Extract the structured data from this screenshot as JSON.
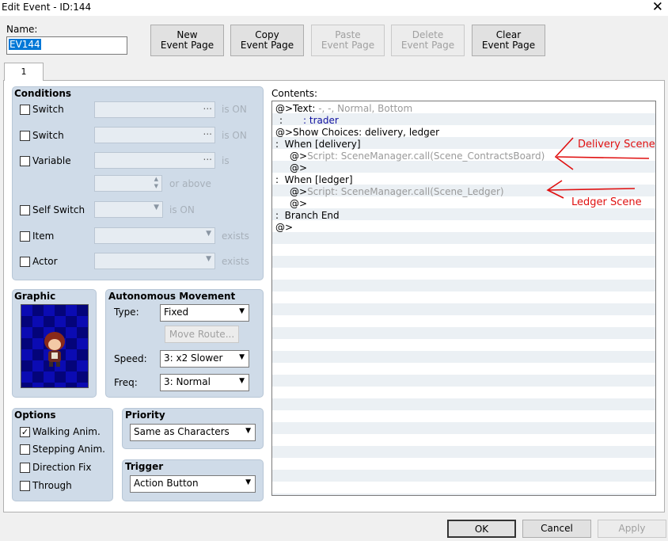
{
  "window": {
    "title": "Edit Event - ID:144",
    "close_glyph": "✕"
  },
  "name_label": "Name:",
  "name_value": "EV144",
  "toolbar": {
    "new_line1": "New",
    "new_line2": "Event Page",
    "copy_line1": "Copy",
    "copy_line2": "Event Page",
    "paste_line1": "Paste",
    "paste_line2": "Event Page",
    "delete_line1": "Delete",
    "delete_line2": "Event Page",
    "clear_line1": "Clear",
    "clear_line2": "Event Page"
  },
  "tabs": [
    {
      "label": "1"
    }
  ],
  "conditions": {
    "title": "Conditions",
    "switch1_label": "Switch",
    "switch1_suffix": "is ON",
    "switch2_label": "Switch",
    "switch2_suffix": "is ON",
    "variable_label": "Variable",
    "variable_suffix": "is",
    "variable_above": "or above",
    "self_switch_label": "Self Switch",
    "self_switch_suffix": "is ON",
    "item_label": "Item",
    "item_suffix": "exists",
    "actor_label": "Actor",
    "actor_suffix": "exists"
  },
  "graphic": {
    "title": "Graphic"
  },
  "movement": {
    "title": "Autonomous Movement",
    "type_label": "Type:",
    "type_value": "Fixed",
    "move_route_label": "Move Route...",
    "speed_label": "Speed:",
    "speed_value": "3: x2 Slower",
    "freq_label": "Freq:",
    "freq_value": "3: Normal"
  },
  "options": {
    "title": "Options",
    "walking": "Walking Anim.",
    "walking_checked": true,
    "stepping": "Stepping Anim.",
    "direction_fix": "Direction Fix",
    "through": "Through",
    "check_glyph": "✓"
  },
  "priority": {
    "title": "Priority",
    "value": "Same as Characters"
  },
  "trigger": {
    "title": "Trigger",
    "value": "Action Button"
  },
  "contents": {
    "label": "Contents:",
    "l1_a": "@>Text:",
    "l1_b": "-, -, Normal, Bottom",
    "l2_a": ":",
    "l2_b": ": trader",
    "l3": "@>Show Choices: delivery, ledger",
    "l4": ":  When [delivery]",
    "l5_a": "@>",
    "l5_b": "Script: SceneManager.call(Scene_ContractsBoard)",
    "l6": "@>",
    "l7": ":  When [ledger]",
    "l8_a": "@>",
    "l8_b": "Script: SceneManager.call(Scene_Ledger)",
    "l9": "@>",
    "l10": ":  Branch End",
    "l11": "@>"
  },
  "annotations": {
    "delivery": "Delivery Scene",
    "ledger": "Ledger Scene",
    "color": "#e01010"
  },
  "buttons": {
    "ok": "OK",
    "cancel": "Cancel",
    "apply": "Apply"
  }
}
